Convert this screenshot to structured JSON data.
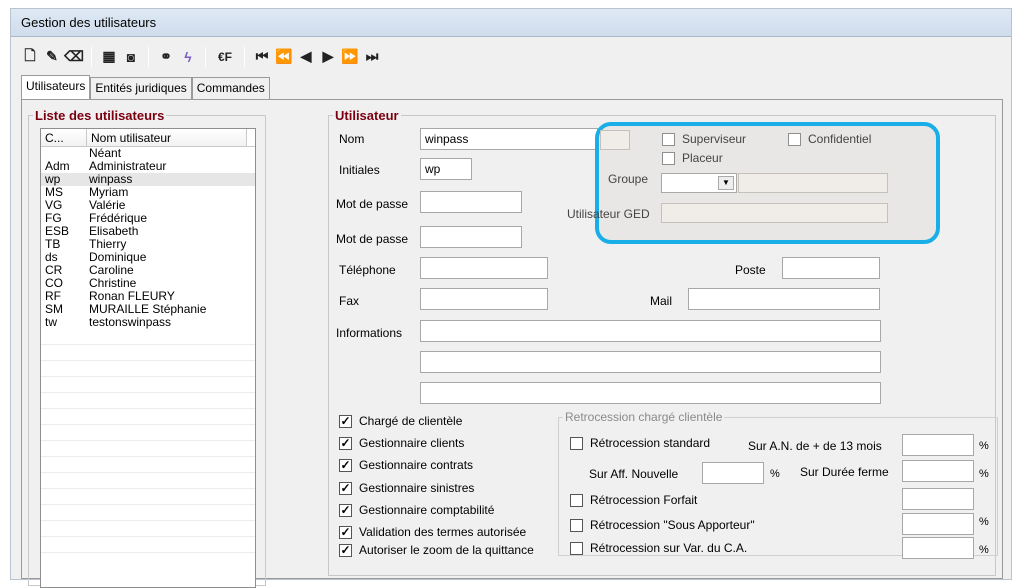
{
  "window": {
    "title": "Gestion des utilisateurs"
  },
  "toolbar": {
    "buttons": [
      "new-icon",
      "edit-icon",
      "eraser-icon",
      "grid-icon",
      "camera-icon",
      "binoculars-icon",
      "lightning-icon",
      "euro-icon",
      "first-icon",
      "prev-page-icon",
      "prev-icon",
      "next-icon",
      "next-page-icon",
      "last-icon"
    ],
    "euro_label": "€F"
  },
  "tabs": [
    {
      "label": "Utilisateurs"
    },
    {
      "label": "Entités juridiques"
    },
    {
      "label": "Commandes"
    }
  ],
  "list": {
    "title": "Liste des utilisateurs",
    "col1": "C...",
    "col2": "Nom utilisateur",
    "rows": [
      {
        "code": "",
        "name": "Néant"
      },
      {
        "code": "Adm",
        "name": "Administrateur"
      },
      {
        "code": "wp",
        "name": "winpass"
      },
      {
        "code": "MS",
        "name": "Myriam"
      },
      {
        "code": "VG",
        "name": "Valérie"
      },
      {
        "code": "FG",
        "name": "Frédérique"
      },
      {
        "code": "ESB",
        "name": "Elisabeth"
      },
      {
        "code": "TB",
        "name": "Thierry"
      },
      {
        "code": "ds",
        "name": "Dominique"
      },
      {
        "code": "CR",
        "name": "Caroline"
      },
      {
        "code": "CO",
        "name": "Christine"
      },
      {
        "code": "RF",
        "name": "Ronan FLEURY"
      },
      {
        "code": "SM",
        "name": "MURAILLE Stéphanie"
      },
      {
        "code": "tw",
        "name": "testonswinpass"
      }
    ]
  },
  "user": {
    "title": "Utilisateur",
    "nom_label": "Nom",
    "nom_value": "winpass",
    "initiales_label": "Initiales",
    "initiales_value": "wp",
    "mdp1_label": "Mot de passe",
    "mdp2_label": "Mot de passe",
    "tel_label": "Téléphone",
    "poste_label": "Poste",
    "fax_label": "Fax",
    "mail_label": "Mail",
    "info_label": "Informations",
    "superviseur": "Superviseur",
    "confidentiel": "Confidentiel",
    "placeur": "Placeur",
    "groupe_label": "Groupe",
    "ged_label": "Utilisateur GED"
  },
  "checks": [
    {
      "label": "Chargé de clientèle",
      "checked": true
    },
    {
      "label": "Gestionnaire clients",
      "checked": true
    },
    {
      "label": "Gestionnaire contrats",
      "checked": true
    },
    {
      "label": "Gestionnaire sinistres",
      "checked": true
    },
    {
      "label": "Gestionnaire comptabilité",
      "checked": true
    },
    {
      "label": "Validation des termes autorisée",
      "checked": true
    },
    {
      "label": "Autoriser le zoom de la quittance",
      "checked": true
    }
  ],
  "retro": {
    "title": "Retrocession chargé clientèle",
    "standard": "Rétrocession standard",
    "sur_an": "Sur A.N. de + de 13 mois",
    "sur_aff": "Sur Aff. Nouvelle",
    "sur_duree": "Sur Durée ferme",
    "forfait": "Rétrocession Forfait",
    "sous_apporteur": "Rétrocession \"Sous Apporteur\"",
    "var_ca": "Rétrocession sur Var. du C.A.",
    "pct": "%"
  },
  "colors": {
    "highlight": "#1aaee8",
    "legend": "#7a0010"
  }
}
